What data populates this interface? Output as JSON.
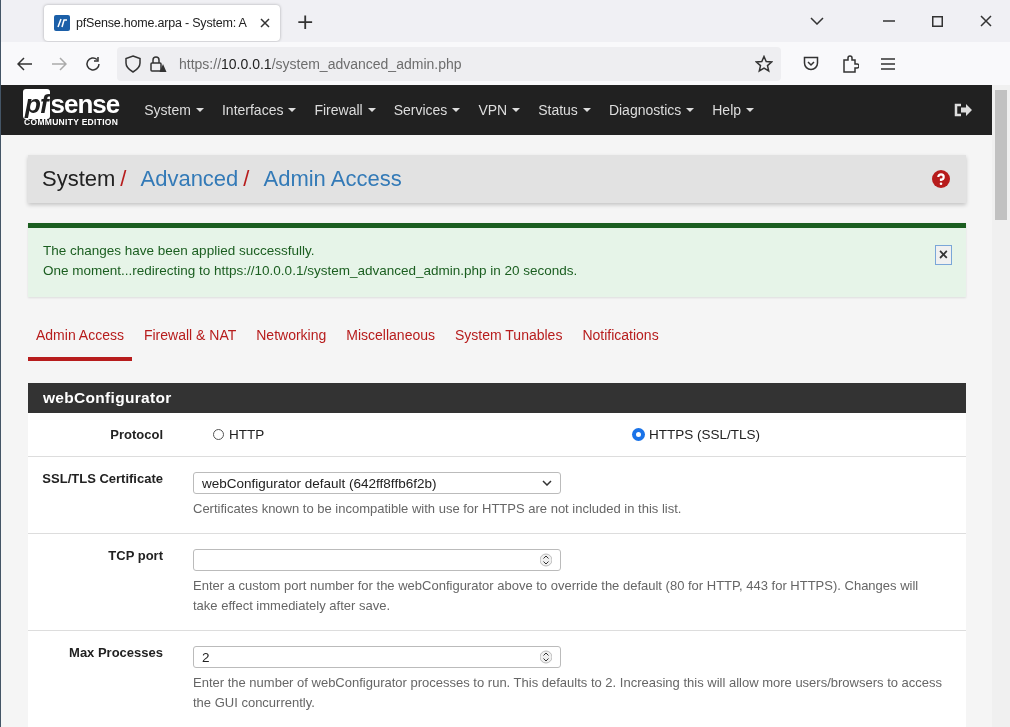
{
  "browser": {
    "tabs": [
      {
        "title": "pfSense.home.arpa - System: A",
        "selected": true
      }
    ],
    "new_tab": "+",
    "url": {
      "scheme": "https://",
      "host": "10.0.0.1",
      "path": "/system_advanced_admin.php"
    }
  },
  "navbar": {
    "logo": {
      "mark": "pf",
      "word": "sense",
      "edition": "COMMUNITY EDITION"
    },
    "menus": [
      {
        "label": "System"
      },
      {
        "label": "Interfaces"
      },
      {
        "label": "Firewall"
      },
      {
        "label": "Services"
      },
      {
        "label": "VPN"
      },
      {
        "label": "Status"
      },
      {
        "label": "Diagnostics"
      },
      {
        "label": "Help"
      }
    ]
  },
  "breadcrumb": [
    {
      "label": "System",
      "kind": "plain",
      "separator": "/"
    },
    {
      "label": "Advanced",
      "kind": "link",
      "separator": "/"
    },
    {
      "label": "Admin Access",
      "kind": "link"
    }
  ],
  "alert": {
    "lines": [
      "The changes have been applied successfully.",
      "One moment...redirecting to https://10.0.0.1/system_advanced_admin.php in 20 seconds."
    ],
    "close": "×"
  },
  "tabs": [
    {
      "label": "Admin Access",
      "selected": true
    },
    {
      "label": "Firewall & NAT",
      "selected": false
    },
    {
      "label": "Networking",
      "selected": false
    },
    {
      "label": "Miscellaneous",
      "selected": false
    },
    {
      "label": "System Tunables",
      "selected": false
    },
    {
      "label": "Notifications",
      "selected": false
    }
  ],
  "section": {
    "title": "webConfigurator",
    "rows": [
      {
        "kind": "radio",
        "label": "Protocol",
        "options": [
          {
            "label": "HTTP",
            "selected": false
          },
          {
            "label": "HTTPS (SSL/TLS)",
            "selected": true
          }
        ]
      },
      {
        "kind": "select",
        "label": "SSL/TLS Certificate",
        "value": "webConfigurator default (642ff8ffb6f2b)",
        "help": "Certificates known to be incompatible with use for HTTPS are not included in this list."
      },
      {
        "kind": "number",
        "label": "TCP port",
        "value": "",
        "help": "Enter a custom port number for the webConfigurator above to override the default (80 for HTTP, 443 for HTTPS). Changes will take effect immediately after save."
      },
      {
        "kind": "number",
        "label": "Max Processes",
        "value": "2",
        "help": "Enter the number of webConfigurator processes to run. This defaults to 2. Increasing this will allow more users/browsers to access the GUI concurrently."
      }
    ]
  }
}
